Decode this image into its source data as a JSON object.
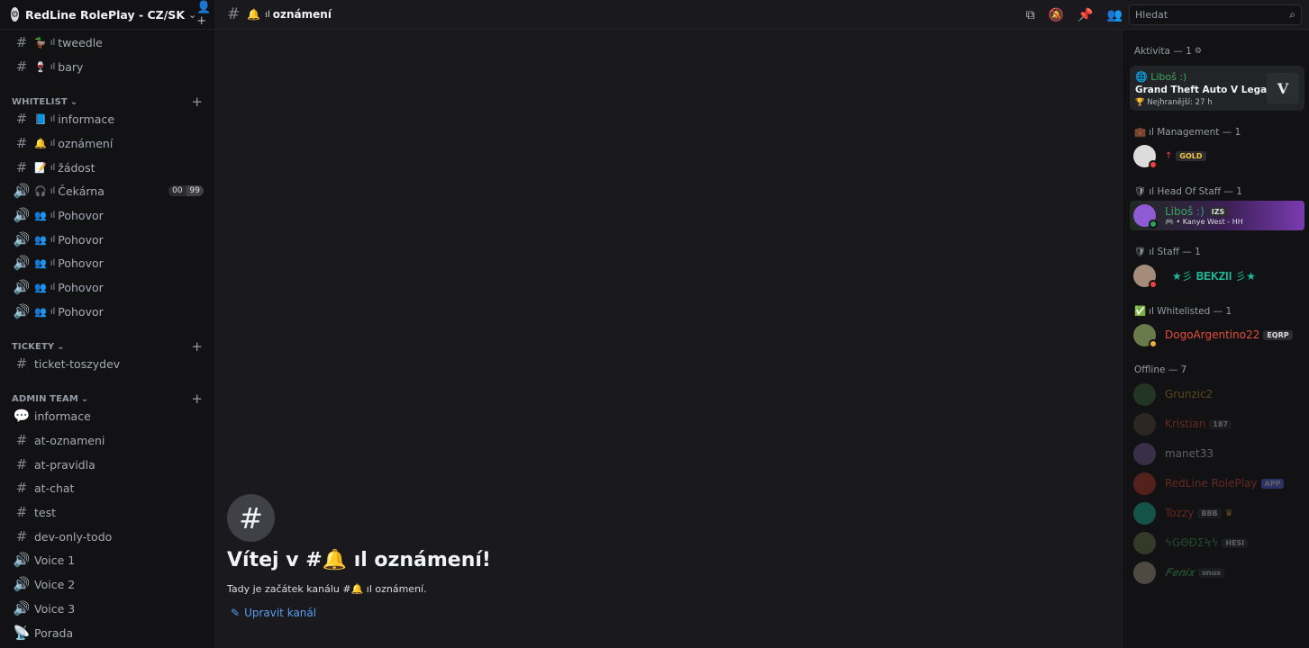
{
  "server": {
    "name": "RedLine RolePlay - CZ/SK"
  },
  "channels_top": [
    {
      "emoji": "🦆",
      "label": "tweedle"
    },
    {
      "emoji": "🍷",
      "label": "bary"
    }
  ],
  "categories": {
    "whitelist": "WHITELIST",
    "tickety": "TICKETY",
    "admin": "ADMIN TEAM"
  },
  "whitelist_channels": [
    {
      "emoji": "📘",
      "label": "informace"
    },
    {
      "emoji": "🔔",
      "label": "oznámení"
    },
    {
      "emoji": "📝",
      "label": "žádost"
    },
    {
      "emoji": "🎧",
      "label": "Čekárna",
      "users_a": "00",
      "users_b": "99"
    },
    {
      "emoji": "👥",
      "label": "Pohovor"
    },
    {
      "emoji": "👥",
      "label": "Pohovor"
    },
    {
      "emoji": "👥",
      "label": "Pohovor"
    },
    {
      "emoji": "👥",
      "label": "Pohovor"
    },
    {
      "emoji": "👥",
      "label": "Pohovor"
    }
  ],
  "ticket_channels": [
    {
      "label": "ticket-toszydev"
    }
  ],
  "admin_channels": [
    {
      "label": "informace"
    },
    {
      "label": "at-oznameni"
    },
    {
      "label": "at-pravidla"
    },
    {
      "label": "at-chat"
    },
    {
      "label": "test"
    },
    {
      "label": "dev-only-todo"
    },
    {
      "label": "Voice 1"
    },
    {
      "label": "Voice 2"
    },
    {
      "label": "Voice 3"
    },
    {
      "label": "Porada"
    }
  ],
  "topbar": {
    "channel_emoji": "🔔",
    "channel_name": "oznámení",
    "search_placeholder": "Hledat"
  },
  "welcome": {
    "title": "Vítej v #🔔 ıl oznámení!",
    "subtitle": "Tady je začátek kanálu #🔔 ıl oznámení.",
    "edit_label": "Upravit kanál"
  },
  "members": {
    "activity_header": "Aktivita — 1",
    "activity": {
      "user": "Liboš :)",
      "game": "Grand Theft Auto V Legacy",
      "time": "Nejhranější: 27 h"
    },
    "groups": [
      {
        "title": "ıl Management — 1",
        "emoji": "💼"
      },
      {
        "title": "ıl Head Of Staff — 1",
        "emoji": "🛡"
      },
      {
        "title": "ıl Staff — 1",
        "emoji": "🛡"
      },
      {
        "title": "ıl Whitelisted — 1",
        "emoji": "✅"
      }
    ],
    "management_tag": "GOLD",
    "head_name": "Liboš :)",
    "head_tag": "IZS",
    "head_sub": "• Kanye West - HH",
    "staff_name": "★彡 𝐁𝐄𝐊𝐙𝐈𝐈 彡★",
    "whitelisted_name": "DogoArgentino22",
    "whitelisted_tag": "EQRP",
    "offline_header": "Offline — 7",
    "offline": [
      {
        "name": "Grunzic2",
        "tag": ""
      },
      {
        "name": "Kristian",
        "tag": "187"
      },
      {
        "name": "manet33",
        "tag": ""
      },
      {
        "name": "RedLine RolePlay",
        "tag": "APP"
      },
      {
        "name": "Tozzy",
        "tag": "BBB"
      },
      {
        "name": "ϟGΘÐΣϞϟ",
        "tag": "HESI"
      },
      {
        "name": "𝑭𝒆𝒏𝒊𝒙",
        "tag": "snus"
      }
    ]
  }
}
